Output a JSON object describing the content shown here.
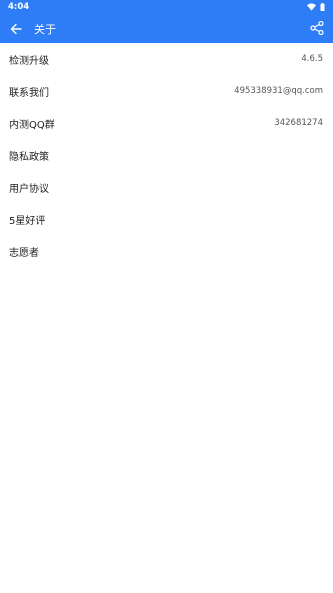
{
  "status": {
    "time": "4:04"
  },
  "appbar": {
    "title": "关于"
  },
  "items": [
    {
      "label": "检测升级",
      "value": "4.6.5"
    },
    {
      "label": "联系我们",
      "value": "495338931@qq.com"
    },
    {
      "label": "内测QQ群",
      "value": "342681274"
    },
    {
      "label": "隐私政策",
      "value": ""
    },
    {
      "label": "用户协议",
      "value": ""
    },
    {
      "label": "5星好评",
      "value": ""
    },
    {
      "label": "志愿者",
      "value": ""
    }
  ],
  "colors": {
    "primary": "#2f7df6"
  }
}
